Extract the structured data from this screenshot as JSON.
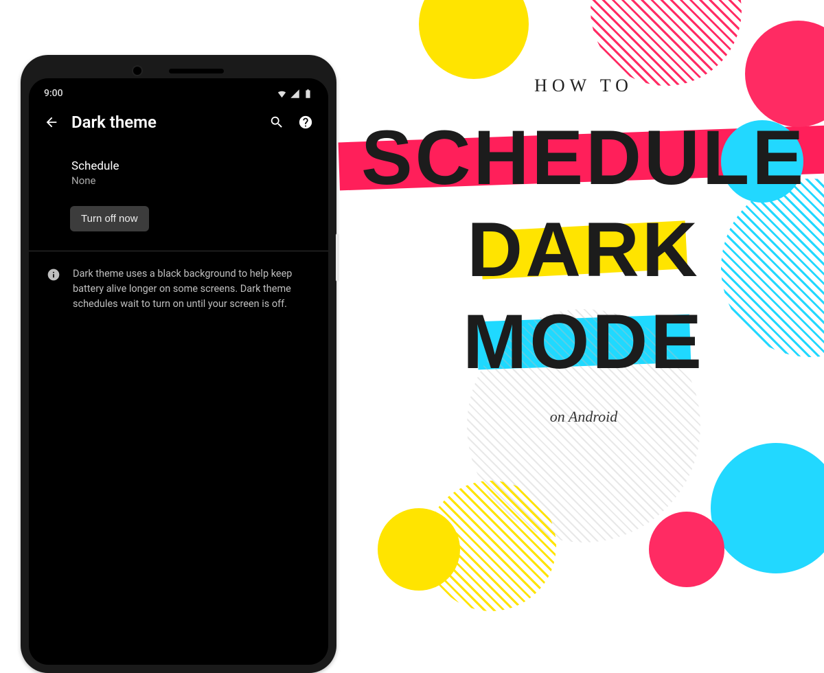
{
  "phone": {
    "statusTime": "9:00",
    "pageTitle": "Dark theme",
    "scheduleLabel": "Schedule",
    "scheduleValue": "None",
    "turnOffButton": "Turn off now",
    "infoText": "Dark theme uses a black background to help keep battery alive longer on some screens. Dark theme schedules wait to turn on until your screen is off."
  },
  "headline": {
    "eyebrow": "HOW TO",
    "word1": "SCHEDULE",
    "word2": "DARK",
    "word3": "MODE",
    "subline": "on Android"
  }
}
